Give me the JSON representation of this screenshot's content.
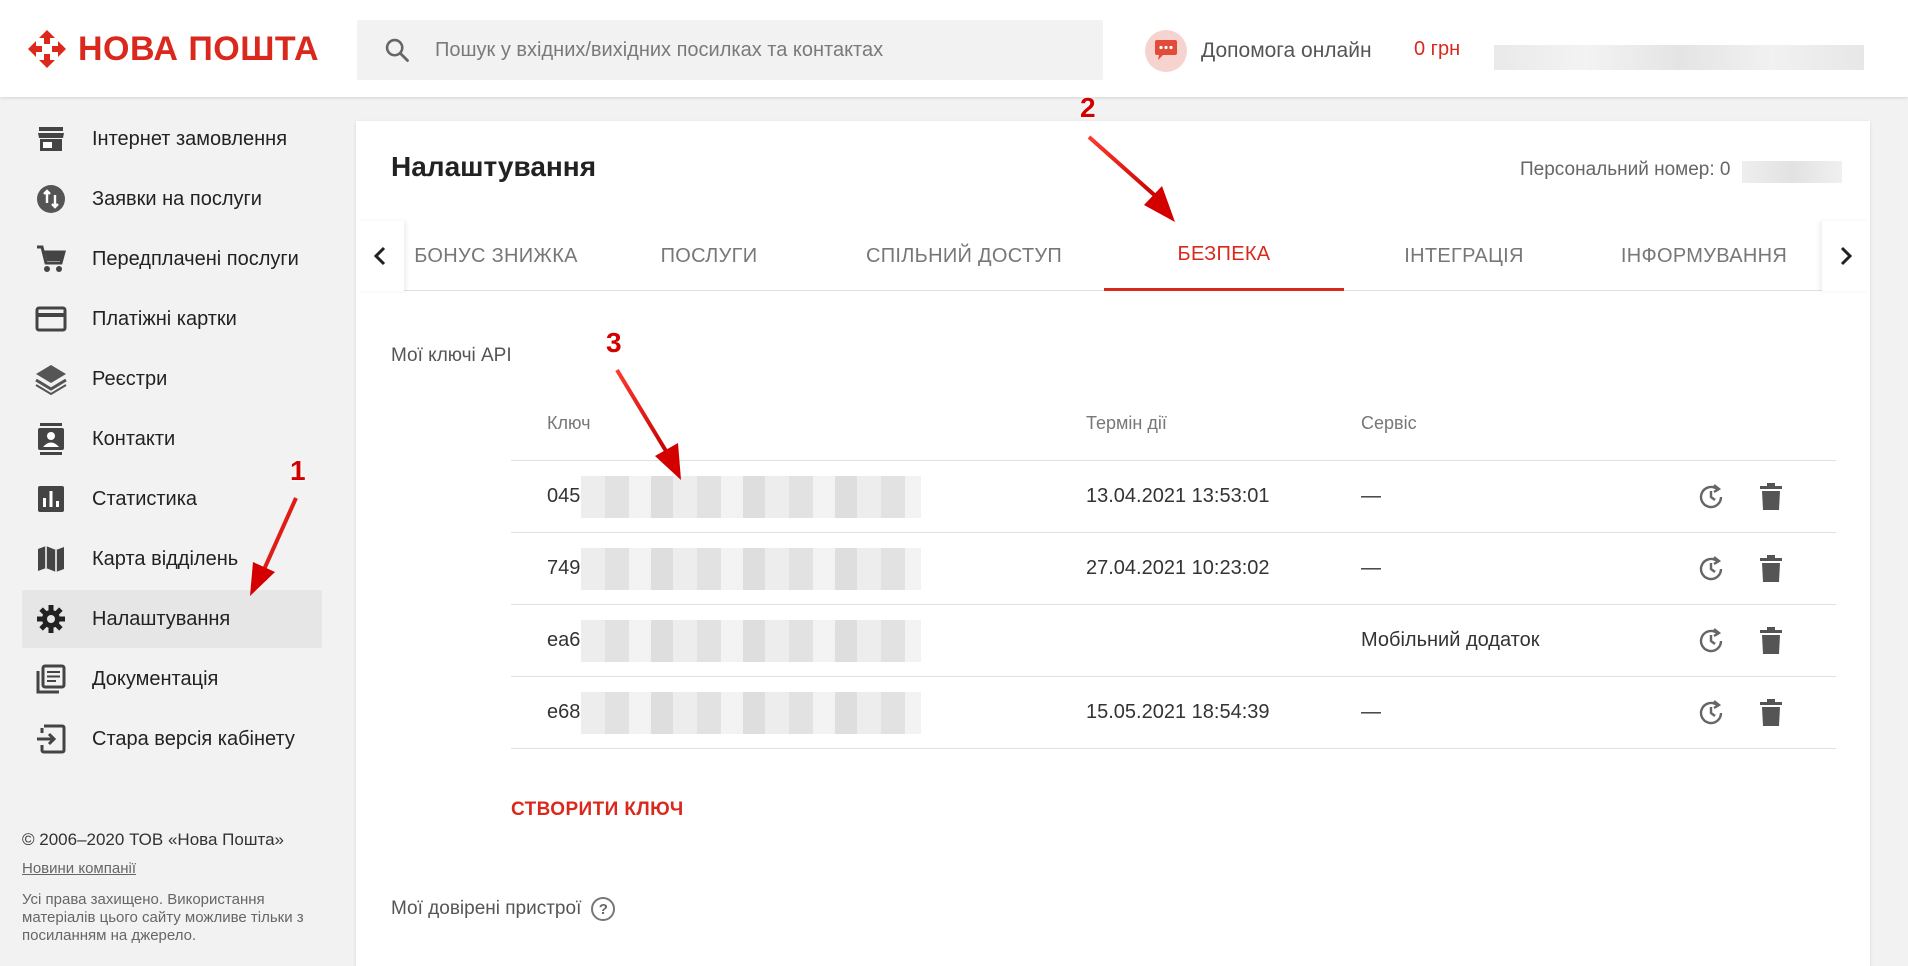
{
  "header": {
    "logo_text": "НОВА ПОШТА",
    "search_placeholder": "Пошук у вхідних/вихідних посилках та контактах",
    "help_label": "Допомога онлайн",
    "balance": "0 грн"
  },
  "sidebar": {
    "items": [
      {
        "label": "Інтернет замовлення",
        "icon": "store-icon"
      },
      {
        "label": "Заявки на послуги",
        "icon": "swap-arrows-icon"
      },
      {
        "label": "Передплачені послуги",
        "icon": "cart-icon"
      },
      {
        "label": "Платіжні картки",
        "icon": "credit-card-icon"
      },
      {
        "label": "Реєстри",
        "icon": "layers-icon"
      },
      {
        "label": "Контакти",
        "icon": "contacts-icon"
      },
      {
        "label": "Статистика",
        "icon": "bar-chart-icon"
      },
      {
        "label": "Карта відділень",
        "icon": "map-icon"
      },
      {
        "label": "Налаштування",
        "icon": "gear-icon",
        "active": true
      },
      {
        "label": "Документація",
        "icon": "library-books-icon"
      },
      {
        "label": "Стара версія кабінету",
        "icon": "exit-to-app-icon"
      }
    ],
    "footer": {
      "copyright": "© 2006–2020 ТОВ «Нова Пошта»",
      "news_link": "Новини компанії",
      "rights": "Усі права захищено. Використання матеріалів цього сайту можливе тільки з посиланням на джерело."
    }
  },
  "main": {
    "title": "Налаштування",
    "personal_number_label": "Персональний номер: 0",
    "tabs": [
      {
        "label": "Бонус знижка"
      },
      {
        "label": "Послуги"
      },
      {
        "label": "Спільний доступ"
      },
      {
        "label": "Безпека",
        "active": true
      },
      {
        "label": "Інтеграція"
      },
      {
        "label": "Інформування"
      }
    ],
    "api_section_label": "Мої ключі API",
    "table": {
      "headers": {
        "key": "Ключ",
        "term": "Термін дії",
        "service": "Сервіс"
      },
      "rows": [
        {
          "key_prefix": "045",
          "term": "13.04.2021 13:53:01",
          "service": "—"
        },
        {
          "key_prefix": "749",
          "term": "27.04.2021 10:23:02",
          "service": "—"
        },
        {
          "key_prefix": "ea6",
          "term": "",
          "service": "Мобільний додаток"
        },
        {
          "key_prefix": "e68",
          "term": "15.05.2021 18:54:39",
          "service": "—"
        }
      ]
    },
    "create_key_label": "СТВОРИТИ КЛЮЧ",
    "trusted_devices_label": "Мої довірені пристрої"
  },
  "annotations": {
    "one": "1",
    "two": "2",
    "three": "3"
  },
  "colors": {
    "brand_red": "#da291c",
    "annotation_red": "#d20000"
  }
}
